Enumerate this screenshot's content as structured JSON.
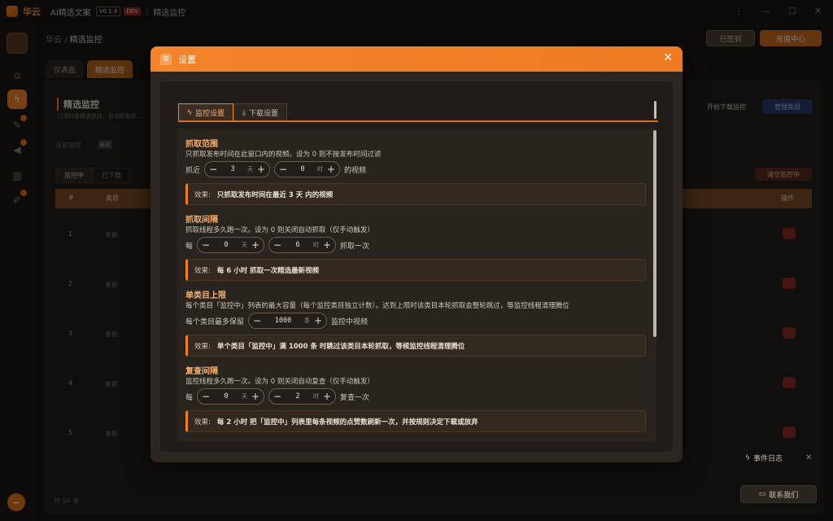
{
  "titlebar": {
    "app_name": "华云",
    "app_sub": "AI精选文案",
    "version": "V0.1.0",
    "env": "DEV",
    "section": "精选监控"
  },
  "header": {
    "breadcrumb_root": "华云",
    "breadcrumb_current": "精选监控",
    "signin_label": "已签到",
    "recharge_label": "充值中心"
  },
  "page_tabs": [
    {
      "label": "仪表盘"
    },
    {
      "label": "精选监控"
    }
  ],
  "page": {
    "title": "精选监控",
    "desc": "订阅抖音精选类目，自动抓取并...",
    "current_monitor_label": "当前监控",
    "current_monitor_tag": "影视",
    "start_download_label": "开始下载监控",
    "manage_categories_label": "管理类目",
    "clear_monitor_label": "清空监控中",
    "sub_tabs": [
      "监控中",
      "已下载"
    ],
    "table_headers": {
      "index": "#",
      "category": "类目",
      "action": "操作"
    },
    "rows": [
      {
        "index": "1",
        "category": "影视"
      },
      {
        "index": "2",
        "category": "影视"
      },
      {
        "index": "3",
        "category": "影视"
      },
      {
        "index": "4",
        "category": "影视"
      },
      {
        "index": "5",
        "category": "影视"
      }
    ],
    "total": "共 54 条",
    "event_log": "事件日志",
    "contact": "联系我们"
  },
  "modal": {
    "title": "设置",
    "tabs": [
      {
        "label": "监控设置"
      },
      {
        "label": "下载设置"
      }
    ],
    "sections": {
      "range": {
        "title": "抓取范围",
        "desc": "只抓取发布时间在此窗口内的视频。设为 0 则不按发布时间过滤",
        "prefix": "抓近",
        "days_value": "3",
        "days_unit": "天",
        "hours_value": "0",
        "hours_unit": "时",
        "suffix": "的视频",
        "effect_label": "效果:",
        "effect_text": "只抓取发布时间在最近 3 天 内的视频"
      },
      "interval": {
        "title": "抓取间隔",
        "desc": "抓取线程多久跑一次。设为 0 则关闭自动抓取（仅手动触发）",
        "prefix": "每",
        "days_value": "0",
        "days_unit": "天",
        "hours_value": "6",
        "hours_unit": "时",
        "suffix": "抓取一次",
        "effect_label": "效果:",
        "effect_text": "每 6 小时 抓取一次精选最新视频"
      },
      "limit": {
        "title": "单类目上限",
        "desc": "每个类目「监控中」列表的最大容量（每个监控类目独立计数）。达到上限时该类目本轮抓取会整轮跳过，等监控线程清理腾位",
        "prefix": "每个类目最多保留",
        "value": "1000",
        "unit": "条",
        "suffix": "监控中视频",
        "effect_label": "效果:",
        "effect_text": "单个类目「监控中」满 1000 条 时跳过该类目本轮抓取，等候监控线程清理腾位"
      },
      "recheck": {
        "title": "复查间隔",
        "desc": "监控线程多久跑一次。设为 0 则关闭自动复查（仅手动触发）",
        "prefix": "每",
        "days_value": "0",
        "days_unit": "天",
        "hours_value": "2",
        "hours_unit": "时",
        "suffix": "复查一次",
        "effect_label": "效果:",
        "effect_text": "每 2 小时 把「监控中」列表里每条视频的点赞数刷新一次，并按规则决定下载或放弃"
      }
    }
  },
  "colors": {
    "accent": "#f07f25",
    "accent_text": "#f5b070",
    "danger": "#8a2a24"
  }
}
